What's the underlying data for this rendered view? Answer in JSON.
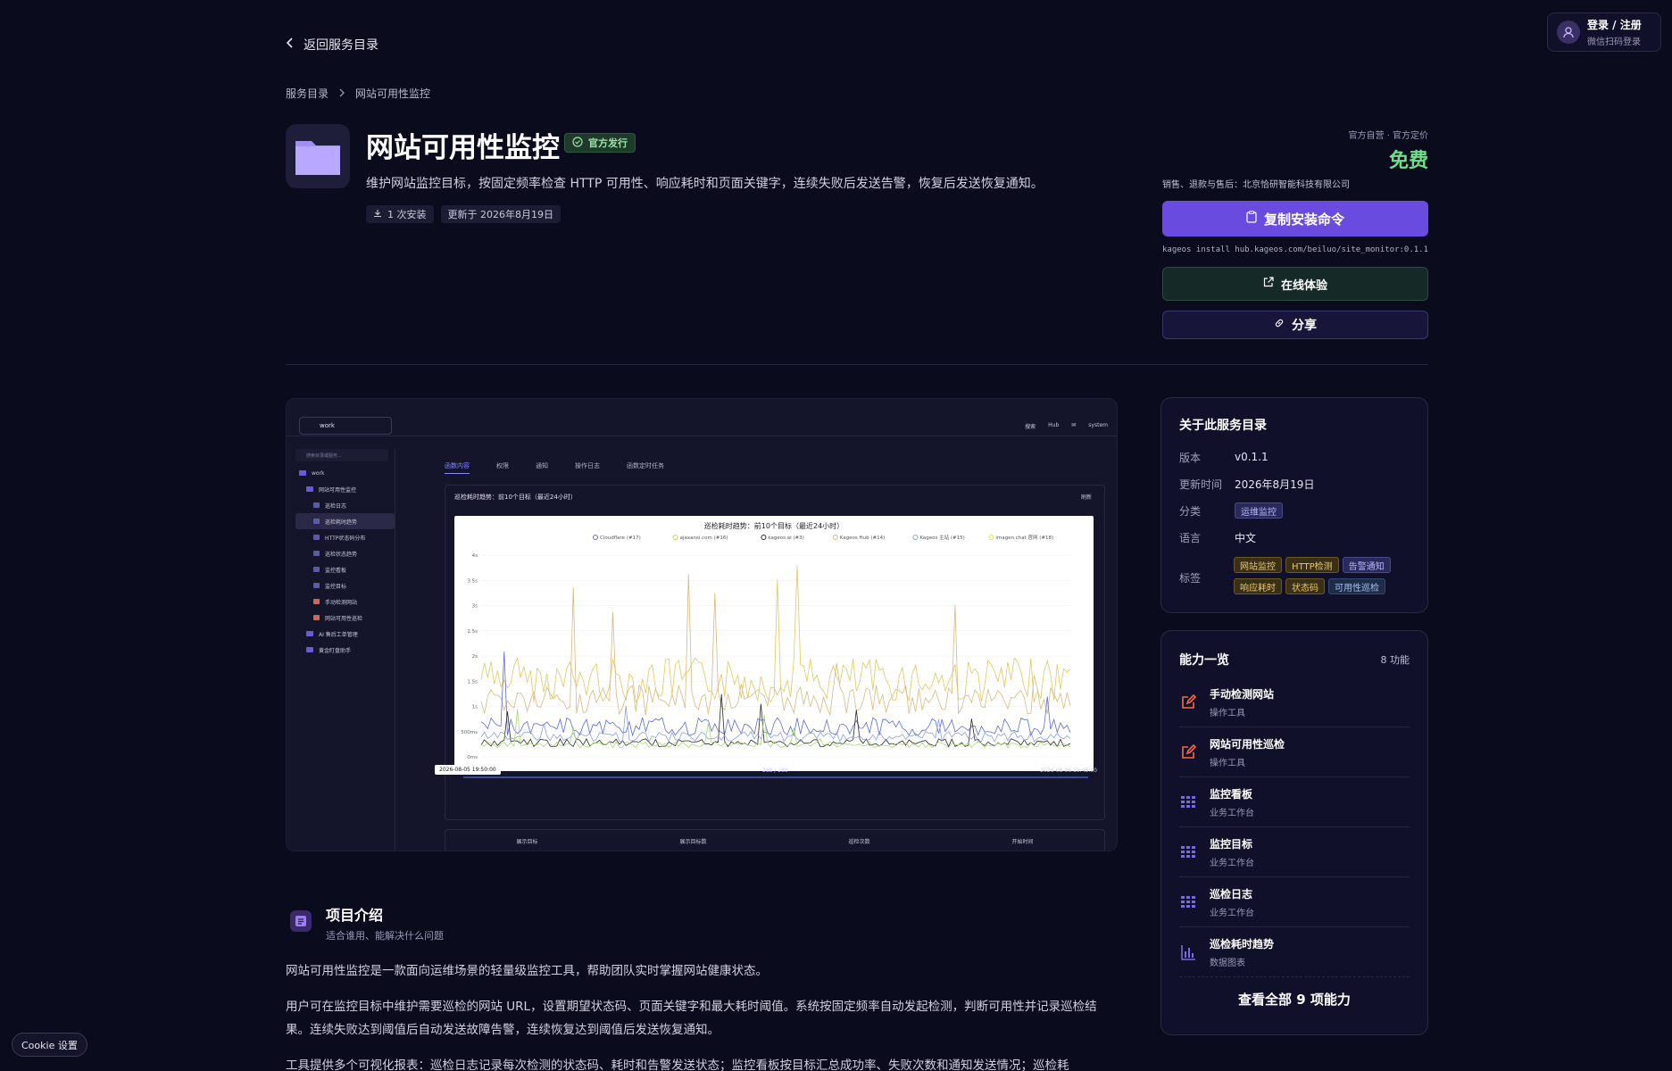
{
  "header": {
    "login_title": "登录 / 注册",
    "login_sub": "微信扫码登录",
    "back_label": "返回服务目录"
  },
  "breadcrumb": [
    "服务目录",
    "网站可用性监控"
  ],
  "app": {
    "title": "网站可用性监控",
    "official_badge": "官方发行",
    "description": "维护网站监控目标，按固定频率检查 HTTP 可用性、响应耗时和页面关键字，连续失败后发送告警，恢复后发送恢复通知。",
    "installs": "1 次安装",
    "updated": "更新于 2026年8月19日"
  },
  "purchase": {
    "pricing_note": "官方自营 · 官方定价",
    "price": "免费",
    "seller": "销售、退款与售后：北京恰研智能科技有限公司",
    "copy_button": "复制安装命令",
    "install_cmd": "kageos install hub.kageos.com/beiluo/site_monitor:0.1.1",
    "try_button": "在线体验",
    "share_button": "分享"
  },
  "preview": {
    "workspace": "work",
    "topbar": [
      "搜索",
      "Hub",
      "✉",
      "system"
    ],
    "search_placeholder": "搜索目录或服务...",
    "tree": [
      {
        "label": "work",
        "level": 0,
        "type": "folder"
      },
      {
        "label": "网站可用性监控",
        "level": 1,
        "type": "folder"
      },
      {
        "label": "巡检日志",
        "level": 2,
        "type": "table"
      },
      {
        "label": "巡检耗时趋势",
        "level": 2,
        "type": "chart",
        "active": true
      },
      {
        "label": "HTTP状态码分布",
        "level": 2,
        "type": "chart"
      },
      {
        "label": "巡检状态趋势",
        "level": 2,
        "type": "chart"
      },
      {
        "label": "监控看板",
        "level": 2,
        "type": "table"
      },
      {
        "label": "监控目标",
        "level": 2,
        "type": "table"
      },
      {
        "label": "手动检测网站",
        "level": 2,
        "type": "tool"
      },
      {
        "label": "网站可用性巡检",
        "level": 2,
        "type": "tool"
      },
      {
        "label": "AI 售后工单管理",
        "level": 1,
        "type": "folder"
      },
      {
        "label": "黄金盯盘助手",
        "level": 1,
        "type": "folder"
      }
    ],
    "tabs": [
      "函数内容",
      "权限",
      "通知",
      "操作日志",
      "函数定时任务"
    ],
    "panel_title": "巡检耗时趋势：前10个目标（最近24小时）",
    "refresh": "刷新",
    "chart_title": "巡检耗时趋势：前10个目标（最近24小时）",
    "legend": [
      "Cloudflare (#17)",
      "ajaxansi.com (#16)",
      "kageos.ai (#3)",
      "Kageos Hub (#14)",
      "Kageos 主站 (#15)",
      "imagen.chat 官网 (#18)"
    ],
    "legend_colors": [
      "#5b6bd8",
      "#e0c860",
      "#2a2a2a",
      "#d8b880",
      "#8aa0e0",
      "#e8d870"
    ],
    "y_ticks": [
      "4s",
      "3.5s",
      "3s",
      "2.5s",
      "2s",
      "1.5s",
      "1s",
      "500ms",
      "0ms"
    ],
    "slider_left": "2026-08-05 19:50:00",
    "slider_mid": "288 / 288",
    "slider_right": "2026-08-06 19:45:00",
    "footer_cols": [
      "展示目标",
      "展示目标数",
      "巡检次数",
      "开始时间"
    ]
  },
  "intro": {
    "title": "项目介绍",
    "subtitle": "适合谁用、能解决什么问题",
    "p1": "网站可用性监控是一款面向运维场景的轻量级监控工具，帮助团队实时掌握网站健康状态。",
    "p2": "用户可在监控目标中维护需要巡检的网站 URL，设置期望状态码、页面关键字和最大耗时阈值。系统按固定频率自动发起检测，判断可用性并记录巡检结果。连续失败达到阈值后自动发送故障告警，连续恢复达到阈值后发送恢复通知。",
    "p3": "工具提供多个可视化报表：巡检日志记录每次检测的状态码、耗时和告警发送状态；监控看板按目标汇总成功率、失败次数和通知发送情况；巡检耗"
  },
  "about": {
    "title": "关于此服务目录",
    "version_k": "版本",
    "version_v": "v0.1.1",
    "updated_k": "更新时间",
    "updated_v": "2026年8月19日",
    "category_k": "分类",
    "category_v": "运维监控",
    "lang_k": "语言",
    "lang_v": "中文",
    "tags_k": "标签",
    "tags": [
      "网站监控",
      "HTTP检测",
      "告警通知",
      "响应耗时",
      "状态码",
      "可用性巡检"
    ]
  },
  "capabilities": {
    "title": "能力一览",
    "count": "8 功能",
    "items": [
      {
        "name": "手动检测网站",
        "type": "操作工具",
        "icon": "edit-icon"
      },
      {
        "name": "网站可用性巡检",
        "type": "操作工具",
        "icon": "edit-icon"
      },
      {
        "name": "监控看板",
        "type": "业务工作台",
        "icon": "table-icon"
      },
      {
        "name": "监控目标",
        "type": "业务工作台",
        "icon": "table-icon"
      },
      {
        "name": "巡检日志",
        "type": "业务工作台",
        "icon": "table-icon"
      },
      {
        "name": "巡检耗时趋势",
        "type": "数据图表",
        "icon": "bar-chart-icon"
      }
    ],
    "view_all": "查看全部 9 项能力"
  },
  "cookie": "Cookie 设置",
  "colors": {
    "accent": "#6a4bdf",
    "price": "#6ee08a",
    "bg": "#0b0b1e"
  }
}
